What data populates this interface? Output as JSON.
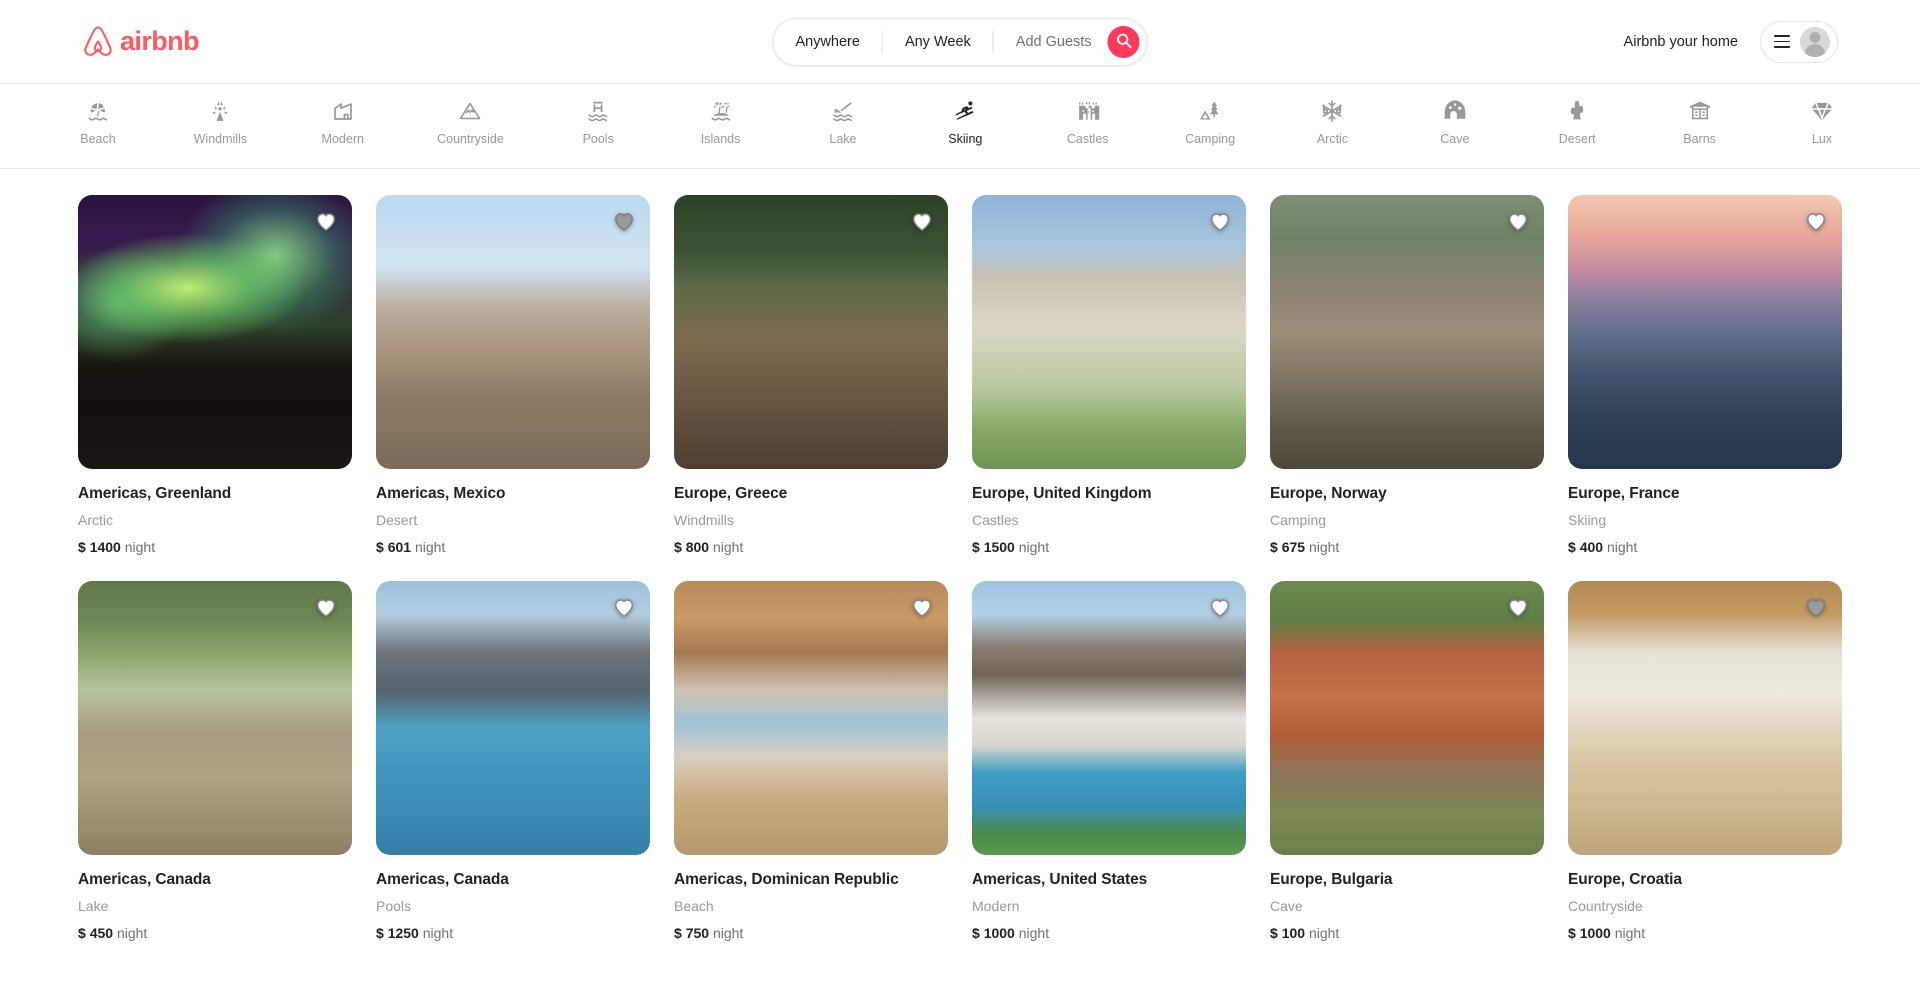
{
  "header": {
    "logo_text": "airbnb",
    "search": {
      "location": "Anywhere",
      "dates": "Any Week",
      "guests_placeholder": "Add Guests",
      "search_icon": "search-icon"
    },
    "host_link": "Airbnb your home",
    "menu_icon": "hamburger-icon",
    "avatar_icon": "user-avatar-icon"
  },
  "categories": [
    {
      "label": "Beach",
      "icon": "beach-umbrella-icon",
      "active": false
    },
    {
      "label": "Windmills",
      "icon": "windmill-icon",
      "active": false
    },
    {
      "label": "Modern",
      "icon": "modern-building-icon",
      "active": false
    },
    {
      "label": "Countryside",
      "icon": "mountain-icon",
      "active": false
    },
    {
      "label": "Pools",
      "icon": "pool-icon",
      "active": false
    },
    {
      "label": "Islands",
      "icon": "island-palm-icon",
      "active": false
    },
    {
      "label": "Lake",
      "icon": "fishing-boat-icon",
      "active": false
    },
    {
      "label": "Skiing",
      "icon": "skier-icon",
      "active": true
    },
    {
      "label": "Castles",
      "icon": "castle-icon",
      "active": false
    },
    {
      "label": "Camping",
      "icon": "tent-tree-icon",
      "active": false
    },
    {
      "label": "Arctic",
      "icon": "snowflake-icon",
      "active": false
    },
    {
      "label": "Cave",
      "icon": "cave-icon",
      "active": false
    },
    {
      "label": "Desert",
      "icon": "cactus-icon",
      "active": false
    },
    {
      "label": "Barns",
      "icon": "barn-icon",
      "active": false
    },
    {
      "label": "Lux",
      "icon": "diamond-icon",
      "active": false
    }
  ],
  "price_prefix": "$",
  "price_suffix": "night",
  "listings": [
    {
      "title": "Americas, Greenland",
      "category": "Arctic",
      "price": "1400",
      "heart": "white",
      "scene": "aurora-cabin"
    },
    {
      "title": "Americas, Mexico",
      "category": "Desert",
      "price": "601",
      "heart": "gray",
      "scene": "desert-house"
    },
    {
      "title": "Europe, Greece",
      "category": "Windmills",
      "price": "800",
      "heart": "white",
      "scene": "windmill-house"
    },
    {
      "title": "Europe, United Kingdom",
      "category": "Castles",
      "price": "1500",
      "heart": "white",
      "scene": "castle-manor"
    },
    {
      "title": "Europe, Norway",
      "category": "Camping",
      "price": "675",
      "heart": "white",
      "scene": "forest-cabin"
    },
    {
      "title": "Europe, France",
      "category": "Skiing",
      "price": "400",
      "heart": "white",
      "scene": "snow-chalet"
    },
    {
      "title": "Americas, Canada",
      "category": "Lake",
      "price": "450",
      "heart": "white",
      "scene": "lake-deck"
    },
    {
      "title": "Americas, Canada",
      "category": "Pools",
      "price": "1250",
      "heart": "white",
      "scene": "pool-villa"
    },
    {
      "title": "Americas, Dominican Republic",
      "category": "Beach",
      "price": "750",
      "heart": "white",
      "scene": "beach-palapa"
    },
    {
      "title": "Americas, United States",
      "category": "Modern",
      "price": "1000",
      "heart": "white",
      "scene": "modern-pool"
    },
    {
      "title": "Europe, Bulgaria",
      "category": "Cave",
      "price": "100",
      "heart": "white",
      "scene": "cave-house"
    },
    {
      "title": "Europe, Croatia",
      "category": "Countryside",
      "price": "1000",
      "heart": "gray",
      "scene": "loft-interior"
    }
  ],
  "colors": {
    "brand": "#FF5A5F",
    "accent": "#FF385C",
    "text": "#222222",
    "muted": "#717171",
    "subtle": "#9a9a9a"
  }
}
